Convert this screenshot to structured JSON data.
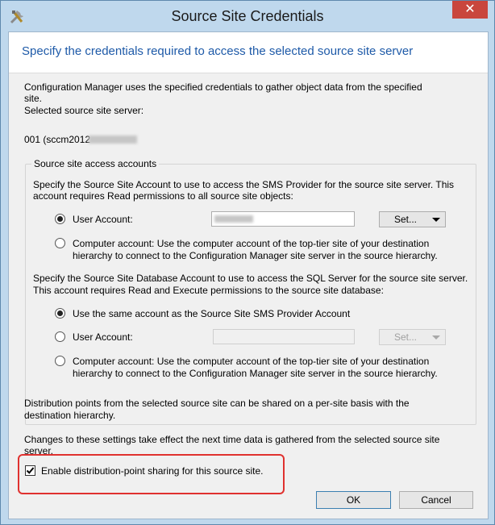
{
  "window": {
    "title": "Source Site Credentials",
    "close_glyph": "✕",
    "app_icon": "tools-icon"
  },
  "header": {
    "text": "Specify the credentials required to access the selected source site server"
  },
  "intro": {
    "line1": "Configuration Manager uses the specified credentials to gather object data from the specified",
    "line2": "site.",
    "line3": "Selected source site server:",
    "server_value": "001 (sccm2012"
  },
  "group": {
    "title": "Source site access accounts",
    "provider_desc_1": "Specify the Source Site Account to use to access the SMS Provider for the source site server. This",
    "provider_desc_2": "account requires Read permissions to all source site objects:",
    "provider_user_account_label": "User Account:",
    "provider_set_button": "Set...",
    "provider_computer_1": "Computer account: Use the computer account of the top-tier site of your destination",
    "provider_computer_2": "hierarchy to connect to the Configuration Manager site server in the source hierarchy.",
    "db_desc_1": "Specify the Source Site Database Account to use to access the SQL Server for the source site server.",
    "db_desc_2": "This account requires Read and Execute permissions to the source site database:",
    "db_same_account_label": "Use the same account as the Source Site SMS Provider Account",
    "db_user_account_label": "User Account:",
    "db_set_button": "Set...",
    "db_computer_1": "Computer account: Use the computer account of the top-tier site of your destination",
    "db_computer_2": "hierarchy to connect to the Configuration Manager site server in the source hierarchy."
  },
  "footer": {
    "dp_text_1": "Distribution points from the selected source site can be shared on a per-site basis with the",
    "dp_text_2": "destination hierarchy.",
    "changes_text_1": "Changes to these settings take effect the next time data is gathered from the selected source site",
    "changes_text_2": "server.",
    "checkbox_label": "Enable distribution-point sharing for this source site.",
    "checkbox_checked": true,
    "ok_button": "OK",
    "cancel_button": "Cancel"
  },
  "colors": {
    "header_text": "#1e5aa8",
    "close_button": "#c9463d",
    "highlight": "#e0312f",
    "titlebar": "#bfd8ed"
  }
}
